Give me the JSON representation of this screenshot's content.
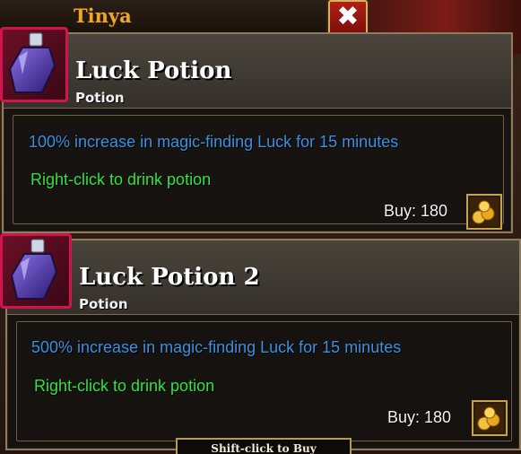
{
  "vendor": {
    "title": "Tinya",
    "close_icon": "close-x-icon",
    "shift_hint": "Shift-click to Buy"
  },
  "tooltips": [
    {
      "name": "Luck Potion",
      "type": "Potion",
      "description": "100% increase in magic-finding Luck for 15 minutes",
      "usage": "Right-click to drink potion",
      "price_label": "Buy: 180",
      "item_icon": "purple-potion-bottle-icon",
      "currency_icon": "gold-coins-icon"
    },
    {
      "name": "Luck Potion 2",
      "type": "Potion",
      "description": "500% increase in magic-finding Luck for 15 minutes",
      "usage": "Right-click to drink potion",
      "price_label": "Buy: 180",
      "item_icon": "purple-potion-bottle-icon",
      "currency_icon": "gold-coins-icon"
    }
  ],
  "colors": {
    "description": "#3d8fe0",
    "usage": "#34e23c",
    "vendor_title": "#e8a82c",
    "icon_border": "#d1144e"
  }
}
